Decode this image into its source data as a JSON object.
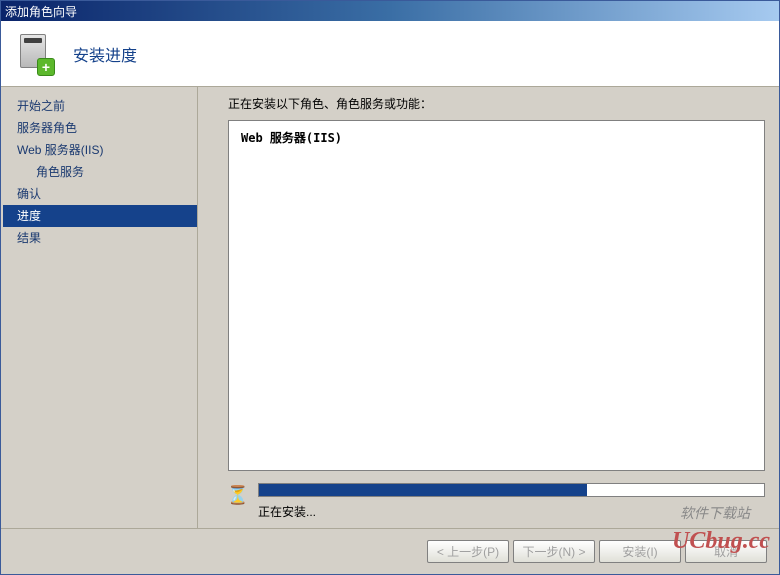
{
  "window": {
    "title": "添加角色向导"
  },
  "header": {
    "title": "安装进度"
  },
  "sidebar": {
    "items": [
      {
        "label": "开始之前",
        "indent": false,
        "selected": false
      },
      {
        "label": "服务器角色",
        "indent": false,
        "selected": false
      },
      {
        "label": "Web 服务器(IIS)",
        "indent": false,
        "selected": false
      },
      {
        "label": "角色服务",
        "indent": true,
        "selected": false
      },
      {
        "label": "确认",
        "indent": false,
        "selected": false
      },
      {
        "label": "进度",
        "indent": false,
        "selected": true
      },
      {
        "label": "结果",
        "indent": false,
        "selected": false
      }
    ]
  },
  "main": {
    "label": "正在安装以下角色、角色服务或功能：",
    "content": "Web 服务器(IIS)",
    "progress_text": "正在安装...",
    "progress_percent": 65
  },
  "footer": {
    "buttons": [
      {
        "label": "< 上一步(P)",
        "disabled": true
      },
      {
        "label": "下一步(N) >",
        "disabled": true
      },
      {
        "label": "安装(I)",
        "disabled": true
      },
      {
        "label": "取消",
        "disabled": true
      }
    ]
  },
  "watermark": {
    "main": "UCbug.cc",
    "sub": "软件下载站"
  }
}
